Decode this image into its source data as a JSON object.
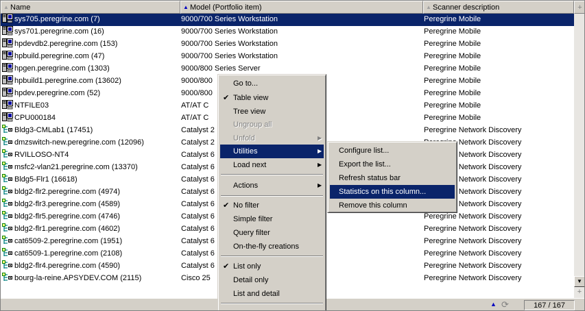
{
  "columns": {
    "name": "Name",
    "model": "Model (Portfolio item)",
    "scanner": "Scanner description"
  },
  "rows": [
    {
      "icon": "computer-icon",
      "name": "sys705.peregrine.com (7)",
      "model": "9000/700 Series Workstation",
      "scanner": "Peregrine Mobile",
      "selected": true
    },
    {
      "icon": "computer-icon",
      "name": "sys701.peregrine.com (16)",
      "model": "9000/700 Series Workstation",
      "scanner": "Peregrine Mobile"
    },
    {
      "icon": "computer-icon",
      "name": "hpdevdb2.peregrine.com (153)",
      "model": "9000/700 Series Workstation",
      "scanner": "Peregrine Mobile"
    },
    {
      "icon": "computer-icon",
      "name": "hpbuild.peregrine.com (47)",
      "model": "9000/700 Series Workstation",
      "scanner": "Peregrine Mobile"
    },
    {
      "icon": "computer-icon",
      "name": "hpgen.peregrine.com (1303)",
      "model": "9000/800 Series Server",
      "scanner": "Peregrine Mobile"
    },
    {
      "icon": "computer-icon",
      "name": "hpbuild1.peregrine.com (13602)",
      "model": "9000/800",
      "scanner": "Peregrine Mobile"
    },
    {
      "icon": "computer-icon",
      "name": "hpdev.peregrine.com (52)",
      "model": "9000/800",
      "scanner": "Peregrine Mobile"
    },
    {
      "icon": "computer-icon",
      "name": "NTFILE03",
      "model": "AT/AT C",
      "scanner": "Peregrine Mobile"
    },
    {
      "icon": "computer-icon",
      "name": "CPU000184",
      "model": "AT/AT C",
      "scanner": "Peregrine Mobile"
    },
    {
      "icon": "network-device-icon",
      "name": "Bldg3-CMLab1 (17451)",
      "model": "Catalyst 2",
      "scanner": "Peregrine Network Discovery"
    },
    {
      "icon": "network-device-icon",
      "name": "dmzswitch-new.peregrine.com (12096)",
      "model": "Catalyst 2",
      "scanner": "Peregrine Network Discovery"
    },
    {
      "icon": "network-device-icon",
      "name": "RVILLOSO-NT4",
      "model": "Catalyst 6",
      "scanner": "Peregrine Network Discovery"
    },
    {
      "icon": "network-device-icon",
      "name": "msfc2-vlan21.peregrine.com (13370)",
      "model": "Catalyst 6",
      "scanner": "Peregrine Network Discovery"
    },
    {
      "icon": "network-device-icon",
      "name": "Bldg5-Flr1 (16618)",
      "model": "Catalyst 6",
      "scanner": "Peregrine Network Discovery"
    },
    {
      "icon": "network-device-icon",
      "name": "bldg2-flr2.peregrine.com (4974)",
      "model": "Catalyst 6",
      "scanner": "Peregrine Network Discovery"
    },
    {
      "icon": "network-device-icon",
      "name": "bldg2-flr3.peregrine.com (4589)",
      "model": "Catalyst 6",
      "scanner": "Peregrine Network Discovery"
    },
    {
      "icon": "network-device-icon",
      "name": "bldg2-flr5.peregrine.com (4746)",
      "model": "Catalyst 6",
      "scanner": "Peregrine Network Discovery"
    },
    {
      "icon": "network-device-icon",
      "name": "bldg2-flr1.peregrine.com (4602)",
      "model": "Catalyst 6",
      "scanner": "Peregrine Network Discovery"
    },
    {
      "icon": "network-device-icon",
      "name": "cat6509-2.peregrine.com (1951)",
      "model": "Catalyst 6",
      "scanner": "Peregrine Network Discovery"
    },
    {
      "icon": "network-device-icon",
      "name": "cat6509-1.peregrine.com (2108)",
      "model": "Catalyst 6",
      "scanner": "Peregrine Network Discovery"
    },
    {
      "icon": "network-device-icon",
      "name": "bldg2-flr4.peregrine.com (4590)",
      "model": "Catalyst 6",
      "scanner": "Peregrine Network Discovery"
    },
    {
      "icon": "network-device-icon",
      "name": "bourg-la-reine.APSYDEV.COM (2115)",
      "model": "Cisco 25",
      "scanner": "Peregrine Network Discovery"
    }
  ],
  "context_menu": [
    {
      "label": "Go to...",
      "checked": false
    },
    {
      "label": "Table view",
      "checked": true
    },
    {
      "label": "Tree view",
      "checked": false
    },
    {
      "label": "Ungroup all",
      "disabled": true
    },
    {
      "label": "Unfold",
      "disabled": true,
      "submenu": true
    },
    {
      "label": "Utilities",
      "submenu": true,
      "highlighted": true
    },
    {
      "label": "Load next",
      "submenu": true
    },
    {
      "label": "Actions",
      "submenu": true
    },
    {
      "label": "No filter",
      "checked": true
    },
    {
      "label": "Simple filter"
    },
    {
      "label": "Query filter"
    },
    {
      "label": "On-the-fly creations"
    },
    {
      "label": "List only",
      "checked": true
    },
    {
      "label": "Detail only"
    },
    {
      "label": "List and detail"
    }
  ],
  "utilities_submenu": [
    {
      "label": "Configure list..."
    },
    {
      "label": "Export the list..."
    },
    {
      "label": "Refresh status bar"
    },
    {
      "label": "Statistics on this column...",
      "highlighted": true
    },
    {
      "label": "Remove this column"
    }
  ],
  "status": {
    "count": "167 / 167"
  },
  "colors": {
    "selection": "#0a246a",
    "face": "#d4d0c8"
  }
}
